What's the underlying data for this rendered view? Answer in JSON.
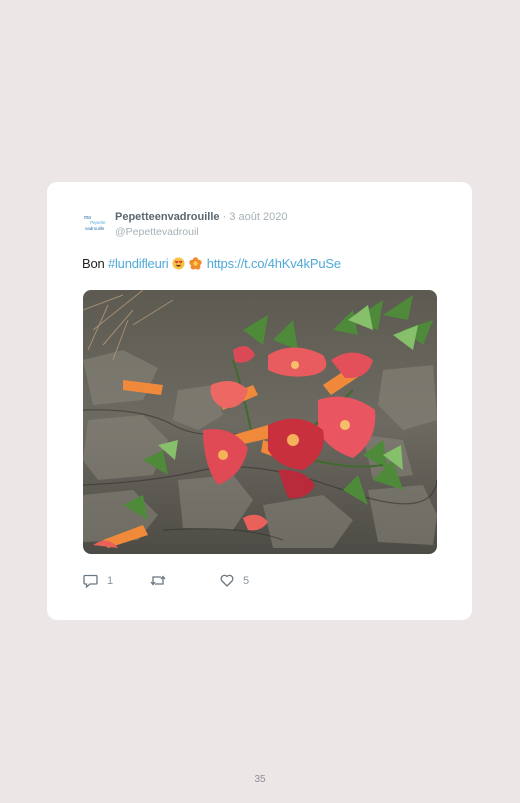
{
  "tweet": {
    "author_name": "Pepetteenvadrouille",
    "separator": "·",
    "date": "3 août 2020",
    "handle": "@Pepettevadrouil",
    "text_prefix": "Bon",
    "hashtag": "#lundifleuri",
    "emojis": [
      "heart-eyes-emoji",
      "flower-emoji"
    ],
    "link": "https://t.co/4hKv4kPuSe",
    "photo_subject": "trumpet-vine-flowers",
    "actions": {
      "reply_count": "1",
      "retweet_count": "",
      "like_count": "5"
    }
  },
  "page_number": "35",
  "colors": {
    "background": "#ece6e6",
    "card": "#ffffff",
    "accent_link": "#4fa9d8",
    "flower": "#e8464a"
  }
}
